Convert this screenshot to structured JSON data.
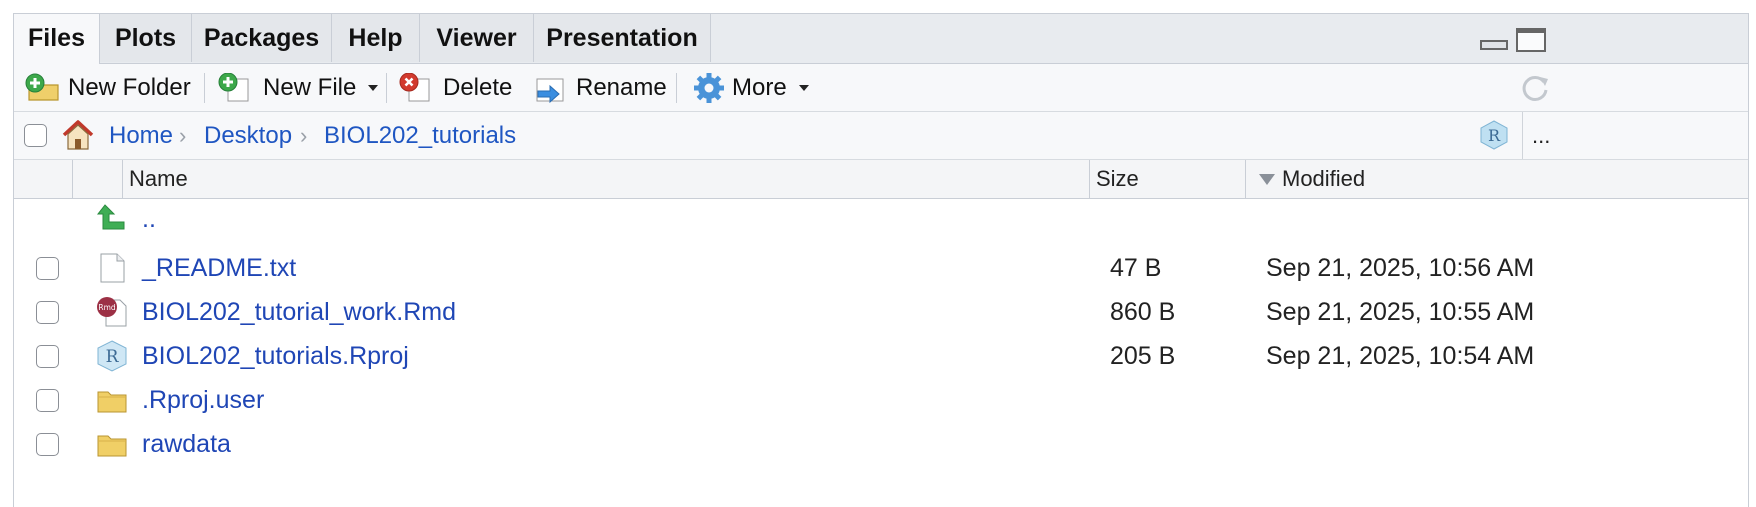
{
  "tabs": [
    {
      "label": "Files",
      "active": true
    },
    {
      "label": "Plots"
    },
    {
      "label": "Packages"
    },
    {
      "label": "Help"
    },
    {
      "label": "Viewer"
    },
    {
      "label": "Presentation"
    }
  ],
  "toolbar": {
    "new_folder": "New Folder",
    "new_file": "New File",
    "delete": "Delete",
    "rename": "Rename",
    "more": "More"
  },
  "breadcrumb": {
    "items": [
      "Home",
      "Desktop",
      "BIOL202_tutorials"
    ],
    "overflow": "..."
  },
  "columns": {
    "name": "Name",
    "size": "Size",
    "modified": "Modified"
  },
  "parent_link": "..",
  "files": [
    {
      "name": "_README.txt",
      "size": "47 B",
      "modified": "Sep 21, 2025, 10:56 AM",
      "icon": "text-file-icon"
    },
    {
      "name": "BIOL202_tutorial_work.Rmd",
      "size": "860 B",
      "modified": "Sep 21, 2025, 10:55 AM",
      "icon": "rmd-file-icon"
    },
    {
      "name": "BIOL202_tutorials.Rproj",
      "size": "205 B",
      "modified": "Sep 21, 2025, 10:54 AM",
      "icon": "rproj-file-icon"
    },
    {
      "name": ".Rproj.user",
      "size": "",
      "modified": "",
      "icon": "folder-icon"
    },
    {
      "name": "rawdata",
      "size": "",
      "modified": "",
      "icon": "folder-icon"
    }
  ],
  "colors": {
    "link": "#1f46b5",
    "tab_bg": "#e4e7eb",
    "toolbar_bg": "#f7f8fa",
    "border": "#c9ced6"
  }
}
